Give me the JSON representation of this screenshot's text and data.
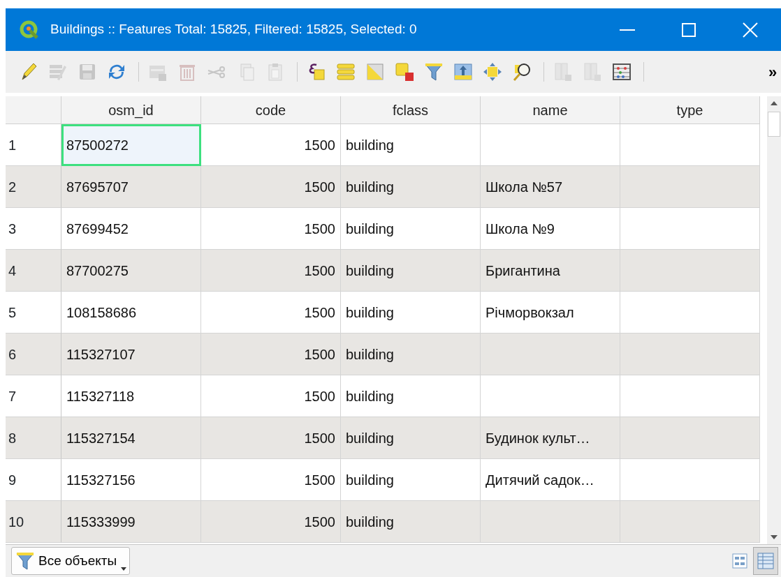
{
  "window": {
    "title": "Buildings :: Features Total: 15825, Filtered: 15825, Selected: 0"
  },
  "toolbar": [
    {
      "kind": "button",
      "disabled": false
    },
    {
      "kind": "button",
      "disabled": true
    },
    {
      "kind": "button",
      "disabled": true
    },
    {
      "kind": "button",
      "disabled": false
    },
    {
      "kind": "separator"
    },
    {
      "kind": "button",
      "disabled": true
    },
    {
      "kind": "button",
      "disabled": true
    },
    {
      "kind": "button",
      "disabled": true
    },
    {
      "kind": "button",
      "disabled": true
    },
    {
      "kind": "button",
      "disabled": true
    },
    {
      "kind": "separator"
    },
    {
      "kind": "button",
      "disabled": false
    },
    {
      "kind": "button",
      "disabled": false
    },
    {
      "kind": "button",
      "disabled": false
    },
    {
      "kind": "button",
      "disabled": false
    },
    {
      "kind": "button",
      "disabled": false
    },
    {
      "kind": "button",
      "disabled": false
    },
    {
      "kind": "button",
      "disabled": false
    },
    {
      "kind": "button",
      "disabled": false
    },
    {
      "kind": "separator"
    },
    {
      "kind": "button",
      "disabled": true
    },
    {
      "kind": "button",
      "disabled": true
    },
    {
      "kind": "button",
      "disabled": false
    },
    {
      "kind": "separator"
    }
  ],
  "toolbar_overflow": "»",
  "table": {
    "columns": [
      "osm_id",
      "code",
      "fclass",
      "name",
      "type"
    ],
    "rows": [
      {
        "number": "1",
        "cells": [
          {
            "value": "87500272",
            "current": true
          },
          {
            "value": "1500",
            "current": false
          },
          {
            "value": "building",
            "current": false
          },
          {
            "current": false
          },
          {
            "current": false
          }
        ]
      },
      {
        "number": "2",
        "cells": [
          {
            "value": "87695707",
            "current": false
          },
          {
            "value": "1500",
            "current": false
          },
          {
            "value": "building",
            "current": false
          },
          {
            "value": "Школа №57",
            "current": false
          },
          {
            "current": false
          }
        ]
      },
      {
        "number": "3",
        "cells": [
          {
            "value": "87699452",
            "current": false
          },
          {
            "value": "1500",
            "current": false
          },
          {
            "value": "building",
            "current": false
          },
          {
            "value": "Школа №9",
            "current": false
          },
          {
            "current": false
          }
        ]
      },
      {
        "number": "4",
        "cells": [
          {
            "value": "87700275",
            "current": false
          },
          {
            "value": "1500",
            "current": false
          },
          {
            "value": "building",
            "current": false
          },
          {
            "value": "Бригантина",
            "current": false
          },
          {
            "current": false
          }
        ]
      },
      {
        "number": "5",
        "cells": [
          {
            "value": "108158686",
            "current": false
          },
          {
            "value": "1500",
            "current": false
          },
          {
            "value": "building",
            "current": false
          },
          {
            "value": "Річморвокзал",
            "current": false
          },
          {
            "current": false
          }
        ]
      },
      {
        "number": "6",
        "cells": [
          {
            "value": "115327107",
            "current": false
          },
          {
            "value": "1500",
            "current": false
          },
          {
            "value": "building",
            "current": false
          },
          {
            "current": false
          },
          {
            "current": false
          }
        ]
      },
      {
        "number": "7",
        "cells": [
          {
            "value": "115327118",
            "current": false
          },
          {
            "value": "1500",
            "current": false
          },
          {
            "value": "building",
            "current": false
          },
          {
            "current": false
          },
          {
            "current": false
          }
        ]
      },
      {
        "number": "8",
        "cells": [
          {
            "value": "115327154",
            "current": false
          },
          {
            "value": "1500",
            "current": false
          },
          {
            "value": "building",
            "current": false
          },
          {
            "value": "Будинок культ…",
            "current": false
          },
          {
            "current": false
          }
        ]
      },
      {
        "number": "9",
        "cells": [
          {
            "value": "115327156",
            "current": false
          },
          {
            "value": "1500",
            "current": false
          },
          {
            "value": "building",
            "current": false
          },
          {
            "value": "Дитячий садок…",
            "current": false
          },
          {
            "current": false
          }
        ]
      },
      {
        "number": "10",
        "cells": [
          {
            "value": "115333999",
            "current": false
          },
          {
            "value": "1500",
            "current": false
          },
          {
            "value": "building",
            "current": false
          },
          {
            "current": false
          },
          {
            "current": false
          }
        ]
      }
    ]
  },
  "filter_button": {
    "label": "Все объекты"
  },
  "view_toggles": [
    {
      "selected": false
    },
    {
      "selected": true
    }
  ]
}
